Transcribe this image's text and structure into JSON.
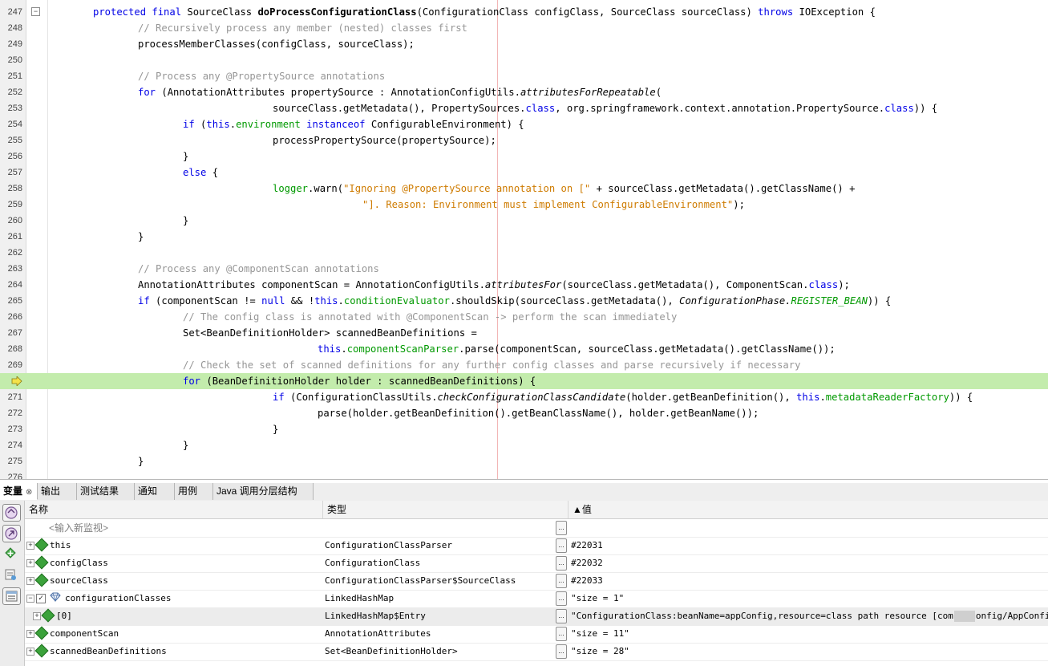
{
  "editor": {
    "lines": [
      {
        "num": "247",
        "indent": 0,
        "parts": [
          [
            "kw",
            "protected final "
          ],
          [
            "",
            "SourceClass "
          ],
          [
            "bold",
            "doProcessConfigurationClass"
          ],
          [
            "",
            "(ConfigurationClass configClass, SourceClass sourceClass) "
          ],
          [
            "kw",
            "throws"
          ],
          [
            "",
            " IOException {"
          ]
        ]
      },
      {
        "num": "248",
        "indent": 1,
        "parts": [
          [
            "cm",
            "// Recursively process any member (nested) classes first"
          ]
        ]
      },
      {
        "num": "249",
        "indent": 1,
        "parts": [
          [
            "",
            "processMemberClasses(configClass, sourceClass);"
          ]
        ]
      },
      {
        "num": "250",
        "indent": 0,
        "parts": []
      },
      {
        "num": "251",
        "indent": 1,
        "parts": [
          [
            "cm",
            "// Process any @PropertySource annotations"
          ]
        ]
      },
      {
        "num": "252",
        "indent": 1,
        "parts": [
          [
            "kw",
            "for"
          ],
          [
            "",
            " (AnnotationAttributes propertySource : AnnotationConfigUtils."
          ],
          [
            "ital",
            "attributesForRepeatable"
          ],
          [
            "",
            "("
          ]
        ]
      },
      {
        "num": "253",
        "indent": 4,
        "parts": [
          [
            "",
            "sourceClass.getMetadata(), PropertySources."
          ],
          [
            "kw",
            "class"
          ],
          [
            "",
            ", org.springframework.context.annotation.PropertySource."
          ],
          [
            "kw",
            "class"
          ],
          [
            "",
            ")) {"
          ]
        ]
      },
      {
        "num": "254",
        "indent": 2,
        "parts": [
          [
            "kw",
            "if"
          ],
          [
            "",
            " ("
          ],
          [
            "kw",
            "this"
          ],
          [
            "",
            "."
          ],
          [
            "fld",
            "environment"
          ],
          [
            "",
            " "
          ],
          [
            "kw",
            "instanceof"
          ],
          [
            "",
            " ConfigurableEnvironment) {"
          ]
        ]
      },
      {
        "num": "255",
        "indent": 4,
        "parts": [
          [
            "",
            "processPropertySource(propertySource);"
          ]
        ]
      },
      {
        "num": "256",
        "indent": 2,
        "parts": [
          [
            "",
            "}"
          ]
        ]
      },
      {
        "num": "257",
        "indent": 2,
        "parts": [
          [
            "kw",
            "else"
          ],
          [
            "",
            " {"
          ]
        ]
      },
      {
        "num": "258",
        "indent": 4,
        "parts": [
          [
            "fld",
            "logger"
          ],
          [
            "",
            ".warn("
          ],
          [
            "str",
            "\"Ignoring @PropertySource annotation on [\""
          ],
          [
            "",
            " + sourceClass.getMetadata().getClassName() +"
          ]
        ]
      },
      {
        "num": "259",
        "indent": 6,
        "parts": [
          [
            "str",
            "\"]. Reason: Environment must implement ConfigurableEnvironment\""
          ],
          [
            "",
            ");"
          ]
        ]
      },
      {
        "num": "260",
        "indent": 2,
        "parts": [
          [
            "",
            "}"
          ]
        ]
      },
      {
        "num": "261",
        "indent": 1,
        "parts": [
          [
            "",
            "}"
          ]
        ]
      },
      {
        "num": "262",
        "indent": 0,
        "parts": []
      },
      {
        "num": "263",
        "indent": 1,
        "parts": [
          [
            "cm",
            "// Process any @ComponentScan annotations"
          ]
        ]
      },
      {
        "num": "264",
        "indent": 1,
        "parts": [
          [
            "",
            "AnnotationAttributes componentScan = AnnotationConfigUtils."
          ],
          [
            "ital",
            "attributesFor"
          ],
          [
            "",
            "(sourceClass.getMetadata(), ComponentScan."
          ],
          [
            "kw",
            "class"
          ],
          [
            "",
            ");"
          ]
        ]
      },
      {
        "num": "265",
        "indent": 1,
        "parts": [
          [
            "kw",
            "if"
          ],
          [
            "",
            " (componentScan != "
          ],
          [
            "kw",
            "null"
          ],
          [
            "",
            " && !"
          ],
          [
            "kw",
            "this"
          ],
          [
            "",
            "."
          ],
          [
            "fld",
            "conditionEvaluator"
          ],
          [
            "",
            ".shouldSkip(sourceClass.getMetadata(), "
          ],
          [
            "ital",
            "ConfigurationPhase."
          ],
          [
            "fldital",
            "REGISTER_BEAN"
          ],
          [
            "",
            ")) {"
          ]
        ]
      },
      {
        "num": "266",
        "indent": 2,
        "parts": [
          [
            "cm",
            "// The config class is annotated with @ComponentScan -> perform the scan immediately"
          ]
        ]
      },
      {
        "num": "267",
        "indent": 2,
        "parts": [
          [
            "",
            "Set<BeanDefinitionHolder> scannedBeanDefinitions ="
          ]
        ]
      },
      {
        "num": "268",
        "indent": 5,
        "parts": [
          [
            "kw",
            "this"
          ],
          [
            "",
            "."
          ],
          [
            "fld",
            "componentScanParser"
          ],
          [
            "",
            ".parse(componentScan, sourceClass.getMetadata().getClassName());"
          ]
        ]
      },
      {
        "num": "269",
        "indent": 2,
        "parts": [
          [
            "cm",
            "// Check the set of scanned definitions for any further config classes and parse recursively if necessary"
          ]
        ]
      },
      {
        "num": "",
        "indent": 2,
        "current": true,
        "parts": [
          [
            "kw",
            "for"
          ],
          [
            "",
            " (BeanDefinitionHolder holder : scannedBeanDefinitions) {"
          ]
        ]
      },
      {
        "num": "271",
        "indent": 4,
        "parts": [
          [
            "kw",
            "if"
          ],
          [
            "",
            " (ConfigurationClassUtils."
          ],
          [
            "ital",
            "checkConfigurationClassCandidate"
          ],
          [
            "",
            "(holder.getBeanDefinition(), "
          ],
          [
            "kw",
            "this"
          ],
          [
            "",
            "."
          ],
          [
            "fld",
            "metadataReaderFactory"
          ],
          [
            "",
            ")) {"
          ]
        ]
      },
      {
        "num": "272",
        "indent": 5,
        "parts": [
          [
            "",
            "parse(holder.getBeanDefinition().getBeanClassName(), holder.getBeanName());"
          ]
        ]
      },
      {
        "num": "273",
        "indent": 4,
        "parts": [
          [
            "",
            "}"
          ]
        ]
      },
      {
        "num": "274",
        "indent": 2,
        "parts": [
          [
            "",
            "}"
          ]
        ]
      },
      {
        "num": "275",
        "indent": 1,
        "parts": [
          [
            "",
            "}"
          ]
        ]
      },
      {
        "num": "276",
        "indent": 0,
        "parts": []
      }
    ]
  },
  "panel": {
    "tabs": [
      {
        "label": "变量",
        "close": "⊗",
        "active": true
      },
      {
        "label": "输出",
        "active": false
      },
      {
        "label": "测试结果",
        "active": false
      },
      {
        "label": "通知",
        "active": false
      },
      {
        "label": "用例",
        "active": false
      },
      {
        "label": "Java 调用分层结构",
        "active": false
      }
    ],
    "columns": {
      "name": "名称",
      "type": "类型",
      "value": "▲值"
    },
    "watch_placeholder": "<输入新监视>",
    "value_button": "...",
    "rows": [
      {
        "name": "this",
        "type": "ConfigurationClassParser",
        "value": "#22031",
        "expand": "+",
        "icon": "field",
        "level": 0
      },
      {
        "name": "configClass",
        "type": "ConfigurationClass",
        "value": "#22032",
        "expand": "+",
        "icon": "field",
        "level": 0
      },
      {
        "name": "sourceClass",
        "type": "ConfigurationClassParser$SourceClass",
        "value": "#22033",
        "expand": "+",
        "icon": "field",
        "level": 0
      },
      {
        "name": "configurationClasses",
        "type": "LinkedHashMap",
        "value": "\"size = 1\"",
        "expand": "−",
        "icon": "gem",
        "checkbox": "✓",
        "level": 0
      },
      {
        "name": "[0]",
        "type": "LinkedHashMap$Entry",
        "value_prefix": "\"ConfigurationClass:beanName=appConfig,resource=class path resource [com",
        "value_suffix": "onfig/AppConfig.class]",
        "expand": "+",
        "icon": "field",
        "level": 1,
        "selected": true
      },
      {
        "name": "componentScan",
        "type": "AnnotationAttributes",
        "value": "\"size = 11\"",
        "expand": "+",
        "icon": "field",
        "level": 0
      },
      {
        "name": "scannedBeanDefinitions",
        "type": "Set<BeanDefinitionHolder>",
        "value": "\"size = 28\"",
        "expand": "+",
        "icon": "field",
        "level": 0
      }
    ]
  }
}
